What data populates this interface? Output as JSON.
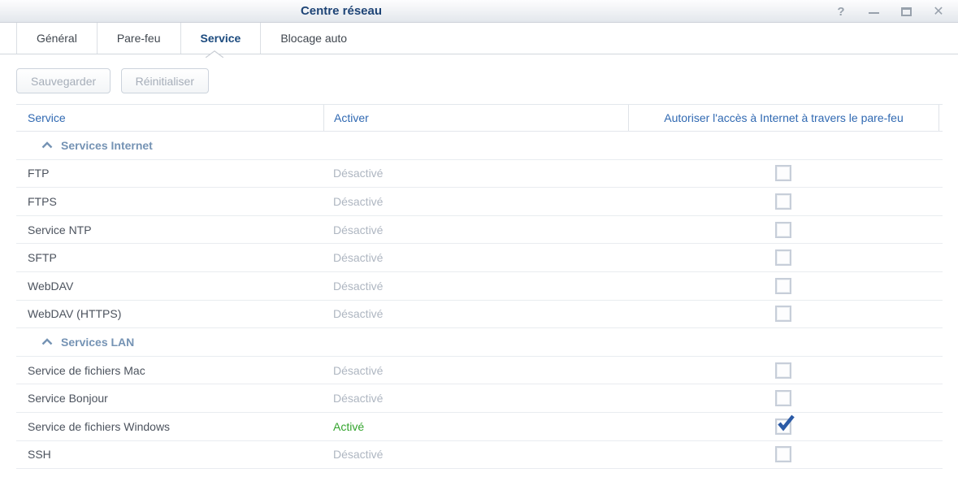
{
  "window": {
    "title": "Centre réseau",
    "controls": {
      "help_glyph": "?",
      "close_glyph": "✕"
    }
  },
  "tabs": [
    {
      "label": "Général",
      "active": false
    },
    {
      "label": "Pare-feu",
      "active": false
    },
    {
      "label": "Service",
      "active": true
    },
    {
      "label": "Blocage auto",
      "active": false
    }
  ],
  "toolbar": {
    "save_label": "Sauvegarder",
    "reset_label": "Réinitialiser"
  },
  "table": {
    "columns": [
      "Service",
      "Activer",
      "Autoriser l'accès à Internet à travers le pare-feu"
    ],
    "groups": [
      {
        "label": "Services Internet",
        "rows": [
          {
            "service": "FTP",
            "status": "Désactivé",
            "enabled": false,
            "firewall_allowed": false
          },
          {
            "service": "FTPS",
            "status": "Désactivé",
            "enabled": false,
            "firewall_allowed": false
          },
          {
            "service": "Service NTP",
            "status": "Désactivé",
            "enabled": false,
            "firewall_allowed": false
          },
          {
            "service": "SFTP",
            "status": "Désactivé",
            "enabled": false,
            "firewall_allowed": false
          },
          {
            "service": "WebDAV",
            "status": "Désactivé",
            "enabled": false,
            "firewall_allowed": false
          },
          {
            "service": "WebDAV (HTTPS)",
            "status": "Désactivé",
            "enabled": false,
            "firewall_allowed": false
          }
        ]
      },
      {
        "label": "Services LAN",
        "rows": [
          {
            "service": "Service de fichiers Mac",
            "status": "Désactivé",
            "enabled": false,
            "firewall_allowed": false
          },
          {
            "service": "Service Bonjour",
            "status": "Désactivé",
            "enabled": false,
            "firewall_allowed": false
          },
          {
            "service": "Service de fichiers Windows",
            "status": "Activé",
            "enabled": true,
            "firewall_allowed": true
          },
          {
            "service": "SSH",
            "status": "Désactivé",
            "enabled": false,
            "firewall_allowed": false
          }
        ]
      }
    ]
  },
  "colors": {
    "title_text": "#1e4476",
    "header_text": "#3069b2",
    "group_text": "#7593b4",
    "status_disabled": "#aeb6c1",
    "status_enabled": "#33a42d",
    "checkmark": "#2b5aa6"
  }
}
